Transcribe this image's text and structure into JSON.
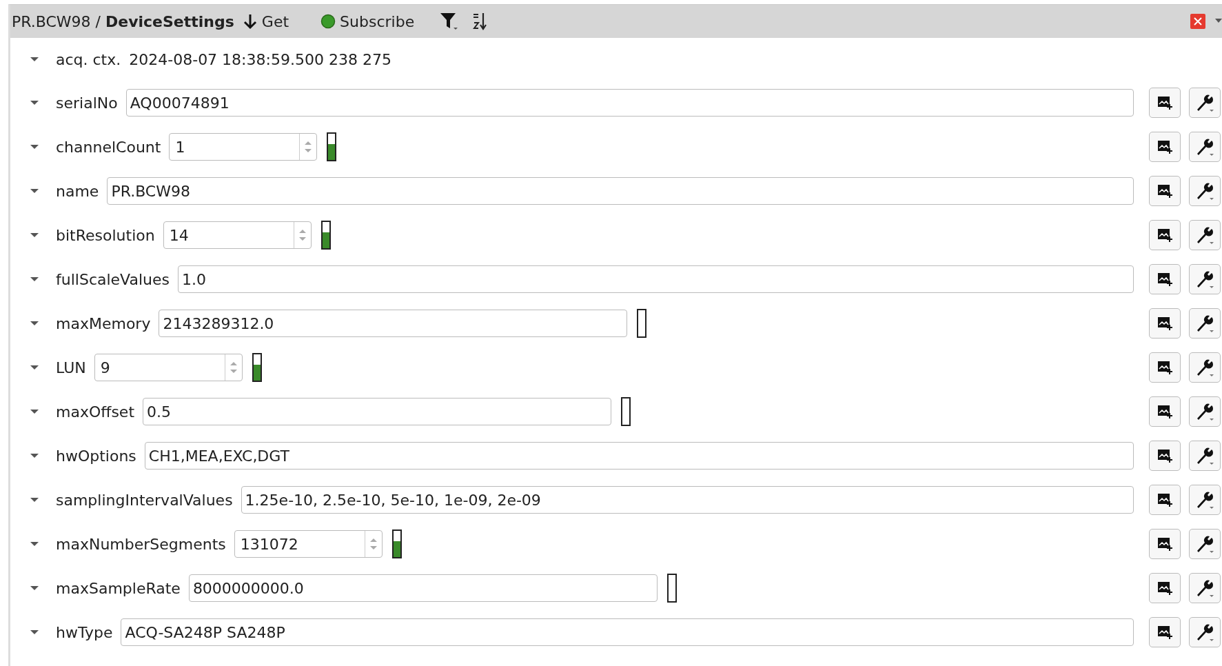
{
  "header": {
    "title": "PR.BCW98 / **DeviceSettings**",
    "get_button": "Get",
    "subscribe_button": "Subscribe",
    "subscribed": true
  },
  "context": {
    "label": "acq. ctx.",
    "value": "2024-08-07 18:38:59.500 238 275",
    "expanded": true
  },
  "fields": [
    {
      "name": "serialNo",
      "kind": "text",
      "value": "AQ00074891",
      "expanded": true
    },
    {
      "name": "channelCount",
      "kind": "spin",
      "value": "1",
      "level": 0.6,
      "expanded": true
    },
    {
      "name": "name",
      "kind": "text",
      "value": "PR.BCW98",
      "expanded": true
    },
    {
      "name": "bitResolution",
      "kind": "spin",
      "value": "14",
      "level": 0.6,
      "expanded": true
    },
    {
      "name": "fullScaleValues",
      "kind": "text",
      "value": "1.0",
      "expanded": true
    },
    {
      "name": "maxMemory",
      "kind": "number",
      "value": "2143289312.0",
      "level": 0,
      "expanded": true
    },
    {
      "name": "LUN",
      "kind": "spin",
      "value": "9",
      "level": 0.6,
      "expanded": true
    },
    {
      "name": "maxOffset",
      "kind": "number",
      "value": "0.5",
      "level": 0,
      "expanded": true
    },
    {
      "name": "hwOptions",
      "kind": "text",
      "value": "CH1,MEA,EXC,DGT",
      "expanded": true
    },
    {
      "name": "samplingIntervalValues",
      "kind": "text",
      "value": "1.25e-10, 2.5e-10, 5e-10, 1e-09, 2e-09",
      "expanded": true
    },
    {
      "name": "maxNumberSegments",
      "kind": "spin",
      "value": "131072",
      "level": 0.6,
      "expanded": true
    },
    {
      "name": "maxSampleRate",
      "kind": "number",
      "value": "8000000000.0",
      "level": 0,
      "expanded": true
    },
    {
      "name": "hwType",
      "kind": "text",
      "value": "ACQ-SA248P SA248P",
      "expanded": true
    }
  ]
}
